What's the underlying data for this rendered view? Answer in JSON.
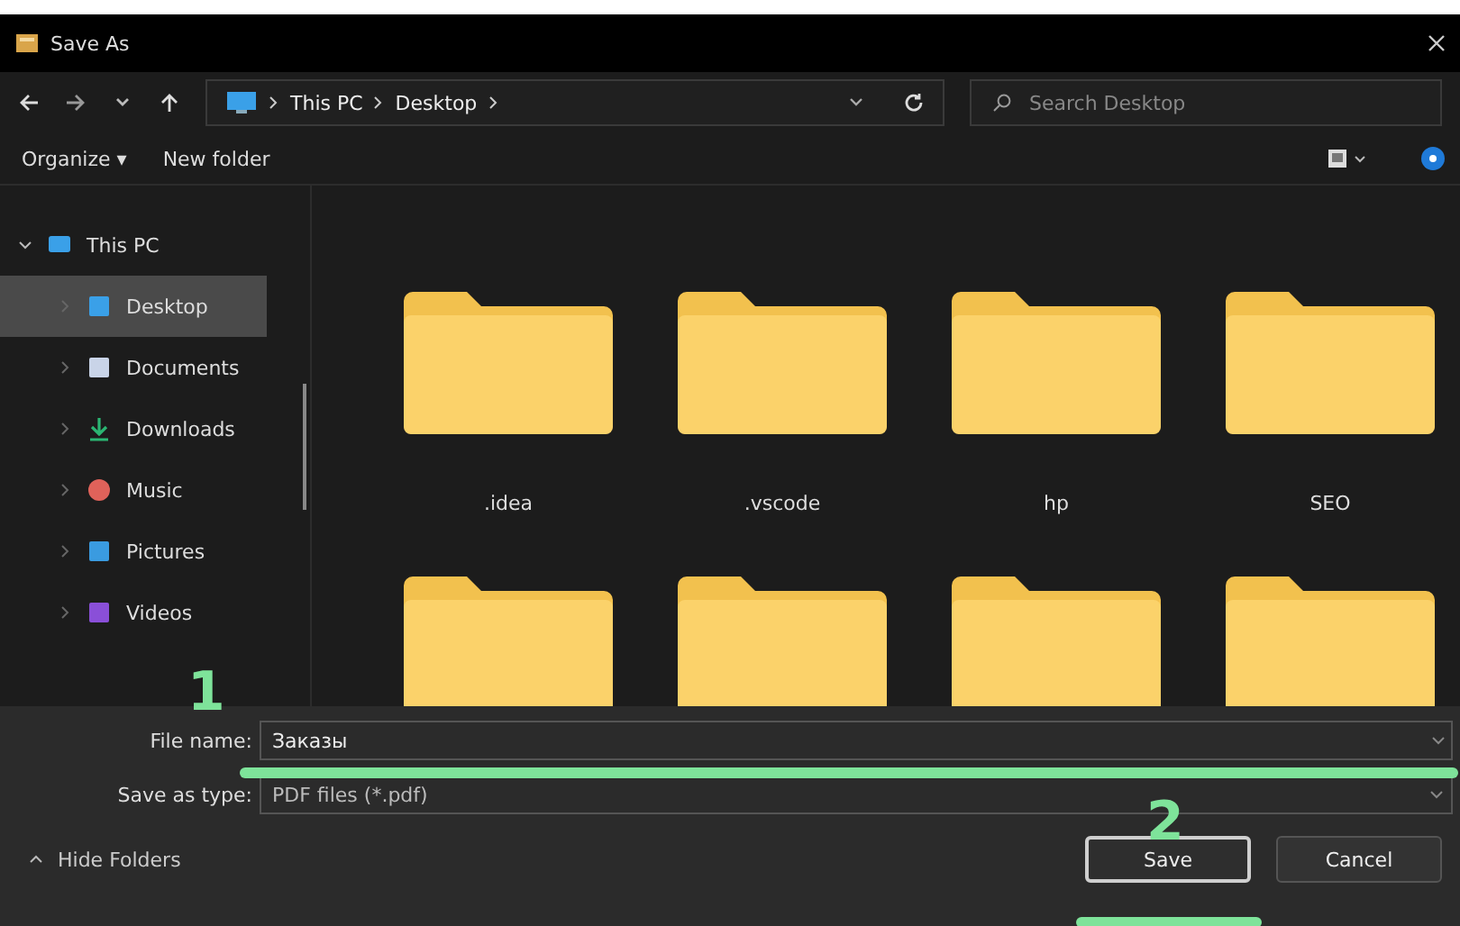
{
  "window": {
    "title": "Save As"
  },
  "address": {
    "crumbs": [
      "This PC",
      "Desktop"
    ]
  },
  "search": {
    "placeholder": "Search Desktop"
  },
  "toolbar": {
    "organize": "Organize ▾",
    "new_folder": "New folder"
  },
  "sidebar": {
    "items": [
      {
        "label": "This PC",
        "expanded": true,
        "selected": false,
        "children": [
          {
            "label": "Desktop",
            "selected": true
          },
          {
            "label": "Documents",
            "selected": false
          },
          {
            "label": "Downloads",
            "selected": false
          },
          {
            "label": "Music",
            "selected": false
          },
          {
            "label": "Pictures",
            "selected": false
          },
          {
            "label": "Videos",
            "selected": false
          }
        ]
      }
    ]
  },
  "files": [
    {
      "kind": "folder",
      "name": ".idea"
    },
    {
      "kind": "folder",
      "name": ".vscode"
    },
    {
      "kind": "folder",
      "name": "hp"
    },
    {
      "kind": "folder",
      "name": "SEO"
    },
    {
      "kind": "folder"
    },
    {
      "kind": "folder"
    },
    {
      "kind": "folder"
    },
    {
      "kind": "folder"
    }
  ],
  "form": {
    "file_name_label": "File name:",
    "file_name": "Заказы",
    "type_label": "Save as type:",
    "type": "PDF files (*.pdf)"
  },
  "footer": {
    "hide_folders": "Hide Folders",
    "buttons": [
      {
        "label": "Save",
        "kind": "primary"
      },
      {
        "label": "Cancel",
        "kind": "secondary"
      }
    ]
  },
  "annotations": [
    {
      "label": "1"
    },
    {
      "label": "2"
    }
  ]
}
